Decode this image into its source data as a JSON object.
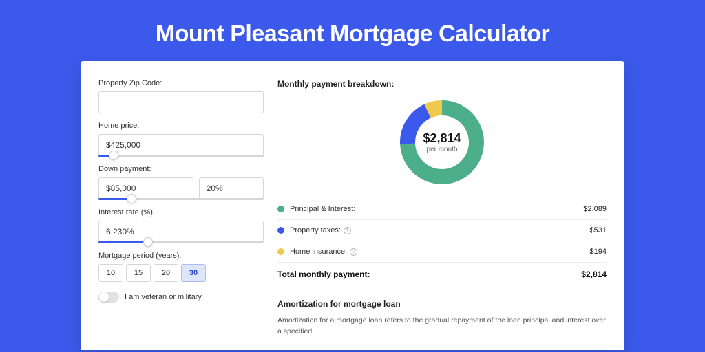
{
  "page": {
    "title": "Mount Pleasant Mortgage Calculator"
  },
  "form": {
    "zip_label": "Property Zip Code:",
    "zip_value": "",
    "home_price_label": "Home price:",
    "home_price_value": "$425,000",
    "home_price_slider_pct": 9,
    "down_payment_label": "Down payment:",
    "down_payment_value": "$85,000",
    "down_payment_pct_value": "20%",
    "down_payment_slider_pct": 20,
    "interest_label": "Interest rate (%):",
    "interest_value": "6.230%",
    "interest_slider_pct": 30,
    "period_label": "Mortgage period (years):",
    "periods": [
      {
        "label": "10",
        "active": false
      },
      {
        "label": "15",
        "active": false
      },
      {
        "label": "20",
        "active": false
      },
      {
        "label": "30",
        "active": true
      }
    ],
    "veteran_label": "I am veteran or military",
    "veteran_on": false
  },
  "breakdown": {
    "title": "Monthly payment breakdown:",
    "center_value": "$2,814",
    "center_sub": "per month",
    "items": [
      {
        "color": "green",
        "label": "Principal & Interest:",
        "value": "$2,089",
        "info": false
      },
      {
        "color": "blue",
        "label": "Property taxes:",
        "value": "$531",
        "info": true
      },
      {
        "color": "yellow",
        "label": "Home insurance:",
        "value": "$194",
        "info": true
      }
    ],
    "total_label": "Total monthly payment:",
    "total_value": "$2,814"
  },
  "amort": {
    "title": "Amortization for mortgage loan",
    "text": "Amortization for a mortgage loan refers to the gradual repayment of the loan principal and interest over a specified"
  },
  "chart_data": {
    "type": "pie",
    "title": "Monthly payment breakdown",
    "series": [
      {
        "name": "Principal & Interest",
        "value": 2089,
        "color": "#4cae8a"
      },
      {
        "name": "Property taxes",
        "value": 531,
        "color": "#3b5aeb"
      },
      {
        "name": "Home insurance",
        "value": 194,
        "color": "#efc94c"
      }
    ],
    "total": 2814,
    "unit": "USD per month"
  }
}
